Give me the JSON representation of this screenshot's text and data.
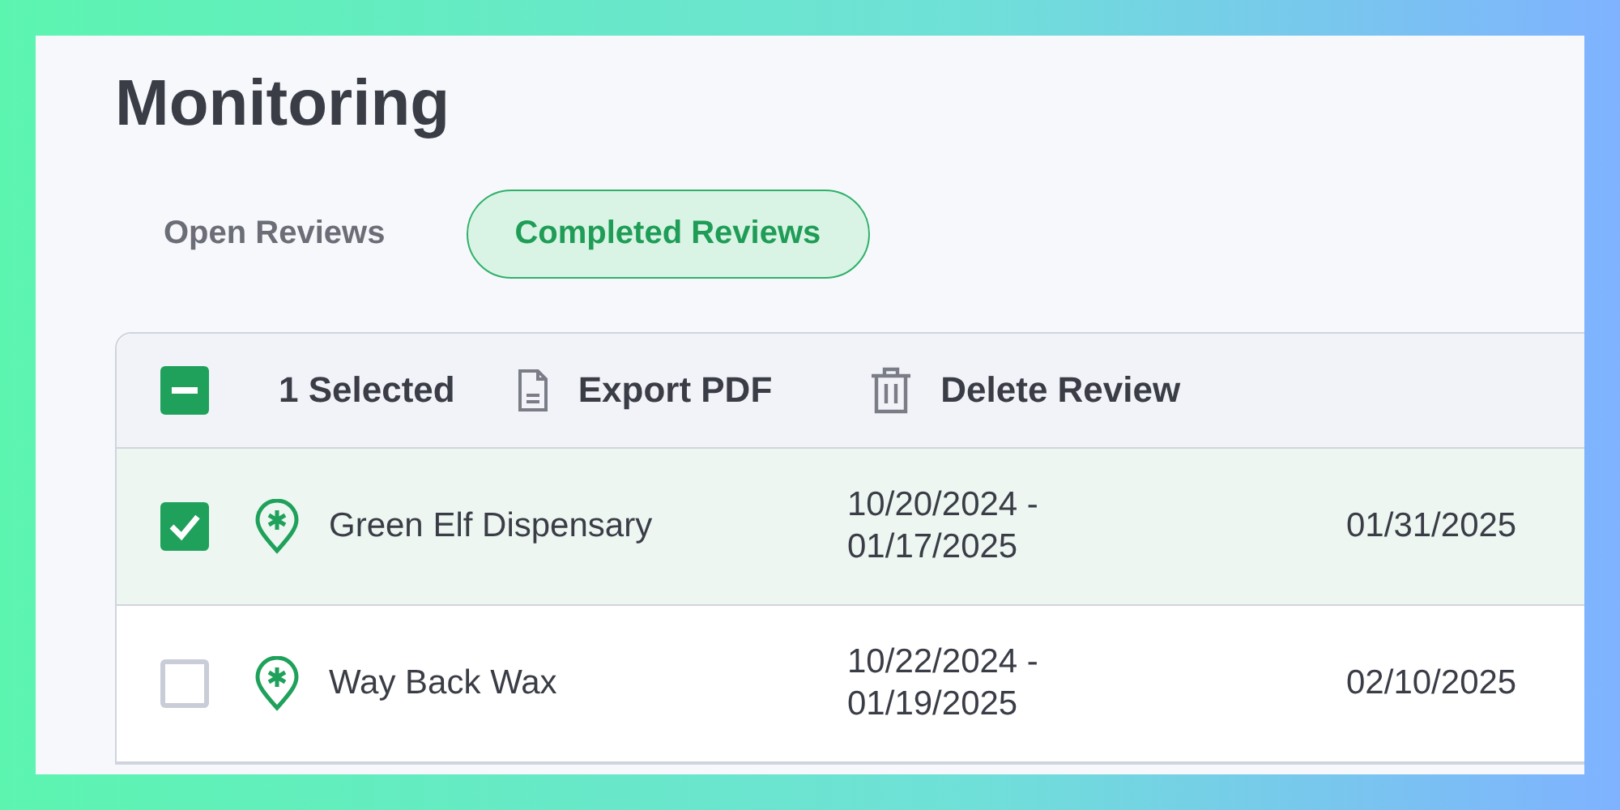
{
  "page": {
    "title": "Monitoring"
  },
  "tabs": [
    {
      "label": "Open Reviews",
      "selected": false
    },
    {
      "label": "Completed Reviews",
      "selected": true
    }
  ],
  "toolbar": {
    "select_all": {
      "checked": true,
      "indeterminate": true
    },
    "selected_count": "1 Selected",
    "actions": [
      {
        "kind": "export",
        "label": "Export PDF"
      },
      {
        "kind": "delete",
        "label": "Delete Review"
      }
    ]
  },
  "table": {
    "rows": [
      {
        "selected": true,
        "name": "Green Elf Dispensary",
        "period": "10/20/2024 - 01/17/2025",
        "date": "01/31/2025"
      },
      {
        "selected": false,
        "name": "Way Back Wax",
        "period": "10/22/2024 - 01/19/2025",
        "date": "02/10/2025"
      }
    ]
  }
}
